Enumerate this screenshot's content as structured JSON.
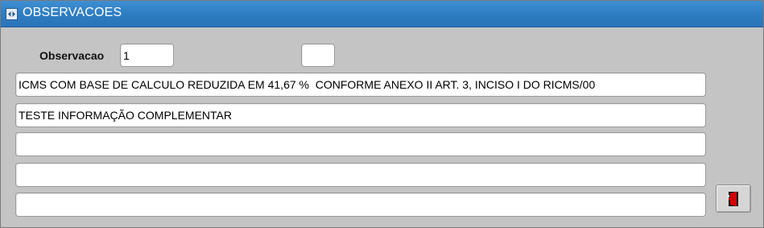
{
  "window": {
    "title": "OBSERVACOES",
    "icon": "form-icon"
  },
  "form": {
    "observacao_label": "Observacao",
    "observacao_value": "1",
    "extra_value": "",
    "lines": [
      "ICMS COM BASE DE CALCULO REDUZIDA EM 41,67 %  CONFORME ANEXO II ART. 3, INCISO I DO RICMS/00",
      "TESTE INFORMAÇÃO COMPLEMENTAR",
      "",
      "",
      ""
    ]
  },
  "exit_button": {
    "icon": "exit-door-icon",
    "accent_color": "#cc0000"
  },
  "colors": {
    "titlebar": "#2d7cc2",
    "background": "#c4c4c4"
  }
}
